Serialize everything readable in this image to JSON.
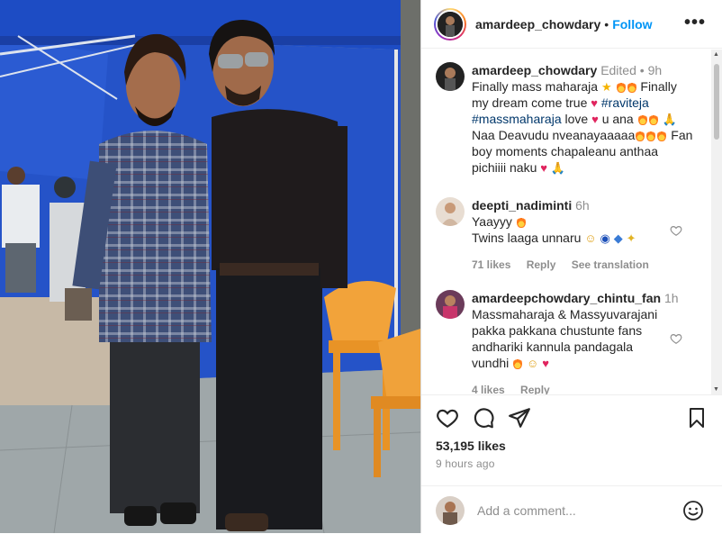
{
  "post": {
    "author": "amardeep_chowdary",
    "follow_label": "Follow",
    "more_icon": "more-horizontal-icon",
    "photo_alt": "Two men standing together in front of a blue tent"
  },
  "caption": {
    "username": "amardeep_chowdary",
    "edited": "Edited",
    "time": "9h",
    "line1": "Finally mass maharaja",
    "line1b": "Finally",
    "line2": "my dream come true",
    "hashtag1": "#raviteja",
    "hashtag2": "#massmaharaja",
    "line3a": "love",
    "line3b": "u ana",
    "line4": "Naa Deavudu nveanayaaaaa",
    "line4b": "Fan",
    "line5": "boy moments chapaleanu anthaa",
    "line6": "pichiiii naku"
  },
  "comments": [
    {
      "username": "deepti_nadiminti",
      "time": "6h",
      "line1": "Yaayyy",
      "line2": "Twins laaga unnaru",
      "likes": "71 likes",
      "reply": "Reply",
      "translate": "See translation"
    },
    {
      "username": "amardeepchowdary_chintu_fan",
      "time": "1h",
      "line1": "Massmaharaja & Massyuvarajani",
      "line2": "pakka pakkana chustunte fans",
      "line3": "andhariki kannula pandagala",
      "line4": "vundhi",
      "likes": "4 likes",
      "reply": "Reply"
    }
  ],
  "footer": {
    "likes": "53,195 likes",
    "ago": "9 hours ago",
    "comment_placeholder": "Add a comment..."
  },
  "colors": {
    "accent": "#0095f6",
    "text": "#262626",
    "muted": "#8e8e8e",
    "tent": "#1e47b8"
  }
}
